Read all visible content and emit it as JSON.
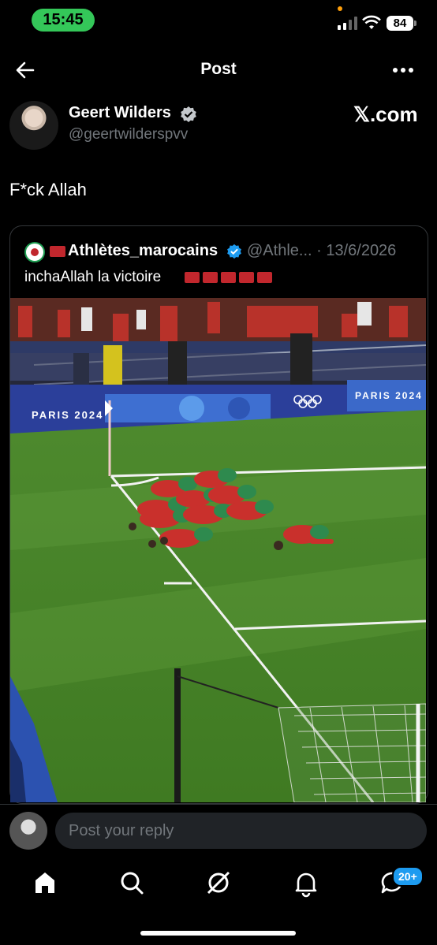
{
  "status_bar": {
    "time": "15:45",
    "battery": "84"
  },
  "header": {
    "title": "Post"
  },
  "author": {
    "name": "Geert Wilders",
    "handle": "@geertwilderspvv",
    "source": "𝕏.com"
  },
  "tweet": {
    "text": "F*ck Allah"
  },
  "quoted": {
    "name": "Athlètes_marocains",
    "meta": "@Athle... · 13/6/2026",
    "text": "inchaAllah la victoire"
  },
  "photo": {
    "banner_left": "PARIS 2024",
    "banner_right": "PARIS 2024"
  },
  "reply": {
    "placeholder": "Post your reply"
  },
  "nav": {
    "messages_badge": "20+"
  }
}
